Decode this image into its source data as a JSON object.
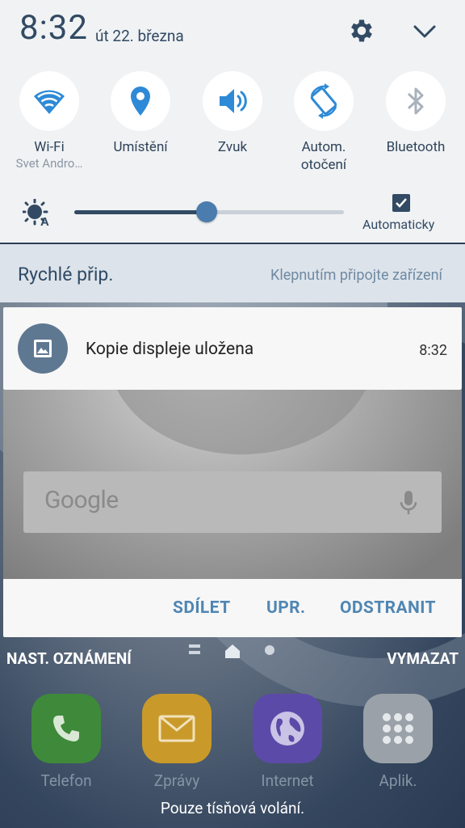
{
  "status": {
    "time": "8:32",
    "date": "út 22. března"
  },
  "tiles": [
    {
      "label": "Wi-Fi",
      "sub": "Svet Andro…",
      "icon": "wifi-icon",
      "active": true
    },
    {
      "label": "Umístění",
      "sub": "",
      "icon": "location-icon",
      "active": true
    },
    {
      "label": "Zvuk",
      "sub": "",
      "icon": "sound-icon",
      "active": true
    },
    {
      "label": "Autom.",
      "label2": "otočení",
      "icon": "auto-rotate-icon",
      "active": true
    },
    {
      "label": "Bluetooth",
      "sub": "",
      "icon": "bluetooth-icon",
      "active": false
    }
  ],
  "brightness": {
    "level": 0.49,
    "auto_label": "Automaticky",
    "auto_checked": true
  },
  "quick_connect": {
    "title": "Rychlé přip.",
    "hint": "Klepnutím připojte zařízení"
  },
  "notification": {
    "title": "Kopie displeje uložena",
    "time": "8:32",
    "search_logo": "Google",
    "actions": {
      "share": "SDÍLET",
      "edit": "UPR.",
      "delete": "ODSTRANIT"
    }
  },
  "bottom": {
    "settings": "NAST. OZNÁMENÍ",
    "clear": "VYMAZAT"
  },
  "dock": [
    {
      "label": "Telefon",
      "icon": "phone-icon",
      "color": "#3e8a3a"
    },
    {
      "label": "Zprávy",
      "icon": "messages-icon",
      "color": "#c99a2a"
    },
    {
      "label": "Internet",
      "icon": "internet-icon",
      "color": "#5c4aa8"
    },
    {
      "label": "Aplik.",
      "icon": "apps-icon",
      "color": "#9aa1a8"
    }
  ],
  "emergency": "Pouze tísňová volání.",
  "colors": {
    "accent": "#324a63",
    "tile_icon_active": "#2e7fd1",
    "action_blue": "#4f86b3"
  }
}
